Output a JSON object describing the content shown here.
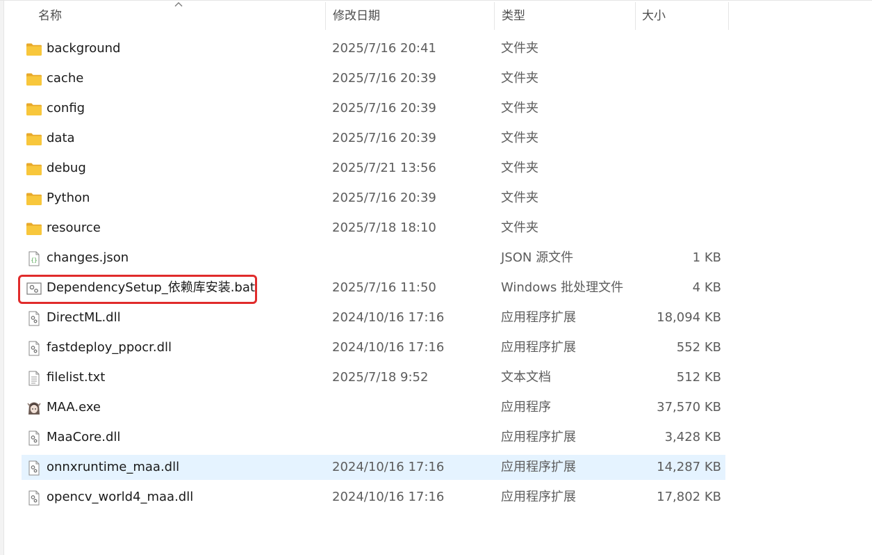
{
  "columns": {
    "name": "名称",
    "date": "修改日期",
    "type": "类型",
    "size": "大小"
  },
  "files": [
    {
      "name": "background",
      "date": "2025/7/16 20:41",
      "type": "文件夹",
      "size": "",
      "icon": "folder-icon"
    },
    {
      "name": "cache",
      "date": "2025/7/16 20:39",
      "type": "文件夹",
      "size": "",
      "icon": "folder-icon"
    },
    {
      "name": "config",
      "date": "2025/7/16 20:39",
      "type": "文件夹",
      "size": "",
      "icon": "folder-icon"
    },
    {
      "name": "data",
      "date": "2025/7/16 20:39",
      "type": "文件夹",
      "size": "",
      "icon": "folder-icon"
    },
    {
      "name": "debug",
      "date": "2025/7/21 13:56",
      "type": "文件夹",
      "size": "",
      "icon": "folder-icon"
    },
    {
      "name": "Python",
      "date": "2025/7/16 20:39",
      "type": "文件夹",
      "size": "",
      "icon": "folder-icon"
    },
    {
      "name": "resource",
      "date": "2025/7/18 18:10",
      "type": "文件夹",
      "size": "",
      "icon": "folder-icon"
    },
    {
      "name": "changes.json",
      "date": "",
      "type": "JSON 源文件",
      "size": "1 KB",
      "icon": "json-file-icon"
    },
    {
      "name": "DependencySetup_依赖库安装.bat",
      "date": "2025/7/16 11:50",
      "type": "Windows 批处理文件",
      "size": "4 KB",
      "icon": "batch-file-icon"
    },
    {
      "name": "DirectML.dll",
      "date": "2024/10/16 17:16",
      "type": "应用程序扩展",
      "size": "18,094 KB",
      "icon": "dll-file-icon"
    },
    {
      "name": "fastdeploy_ppocr.dll",
      "date": "2024/10/16 17:16",
      "type": "应用程序扩展",
      "size": "552 KB",
      "icon": "dll-file-icon"
    },
    {
      "name": "filelist.txt",
      "date": "2025/7/18 9:52",
      "type": "文本文档",
      "size": "512 KB",
      "icon": "text-file-icon"
    },
    {
      "name": "MAA.exe",
      "date": "",
      "type": "应用程序",
      "size": "37,570 KB",
      "icon": "maa-app-icon"
    },
    {
      "name": "MaaCore.dll",
      "date": "",
      "type": "应用程序扩展",
      "size": "3,428 KB",
      "icon": "dll-file-icon"
    },
    {
      "name": "onnxruntime_maa.dll",
      "date": "2024/10/16 17:16",
      "type": "应用程序扩展",
      "size": "14,287 KB",
      "icon": "dll-file-icon",
      "selected": true
    },
    {
      "name": "opencv_world4_maa.dll",
      "date": "2024/10/16 17:16",
      "type": "应用程序扩展",
      "size": "17,802 KB",
      "icon": "dll-file-icon"
    }
  ],
  "colors": {
    "selection": "#e5f3ff",
    "highlight_box": "#e02b2b",
    "folder": "#f8c73c"
  }
}
